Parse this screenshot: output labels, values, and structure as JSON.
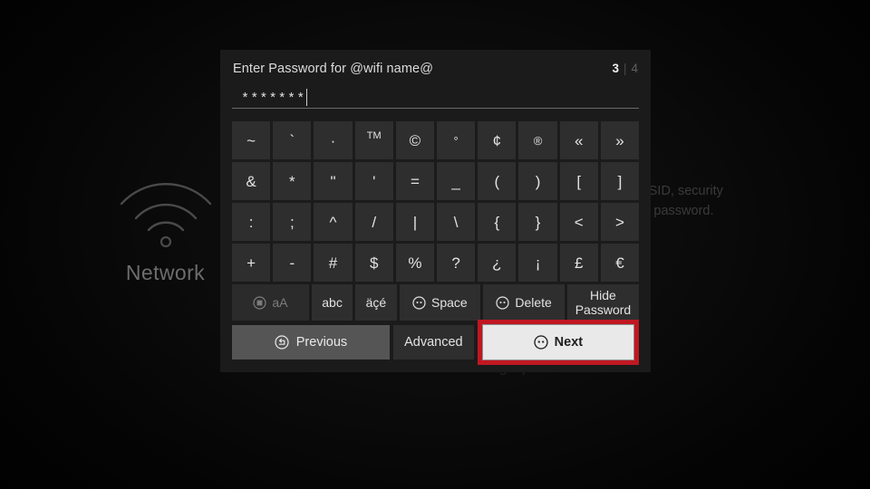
{
  "background": {
    "network_icon": "wifi-icon",
    "network_label": "Network",
    "description": "ecify your SSID, security\n e, and enter password.",
    "description_line1": "ecify your SSID, security",
    "description_line2": "e, and enter password.",
    "tips_label": "Basic Wi-Fi Troubleshooting Tips"
  },
  "dialog": {
    "title": "Enter Password for @wifi name@",
    "step_current": "3",
    "step_separator": "|",
    "step_total": "4",
    "password_field": {
      "value": "*******",
      "masked_char_count": 7,
      "placeholder": ""
    },
    "keyboard": {
      "rows": [
        [
          "~",
          "`",
          "·",
          "TM",
          "©",
          "°",
          "¢",
          "®",
          "«",
          "»"
        ],
        [
          "&",
          "*",
          "\"",
          "'",
          "=",
          "_",
          "(",
          ")",
          "[",
          "]"
        ],
        [
          ":",
          ";",
          "^",
          "/",
          "|",
          "\\",
          "{",
          "}",
          "<",
          ">"
        ],
        [
          "+",
          "-",
          "#",
          "$",
          "%",
          "?",
          "¿",
          "¡",
          "£",
          "€"
        ]
      ],
      "function_keys": [
        {
          "label": "aA",
          "icon": "circle-square-icon",
          "state": "dimmed"
        },
        {
          "label": "abc",
          "icon": "",
          "state": "normal"
        },
        {
          "label": "äçé",
          "icon": "",
          "state": "normal"
        },
        {
          "label": "Space",
          "icon": "remote-ok-icon",
          "state": "normal"
        },
        {
          "label": "Delete",
          "icon": "remote-ok-icon",
          "state": "normal"
        },
        {
          "label_line1": "Hide",
          "label_line2": "Password",
          "icon": "",
          "state": "normal"
        }
      ]
    },
    "actions": {
      "previous": {
        "label": "Previous",
        "icon": "circle-back-arrow-icon"
      },
      "advanced": {
        "label": "Advanced",
        "icon": ""
      },
      "next": {
        "label": "Next",
        "icon": "remote-ok-icon",
        "highlighted": true,
        "highlight_color": "#c01722"
      }
    }
  },
  "colors": {
    "dialog_bg": "#1b1b1b",
    "key_bg": "#2e2e2e",
    "key_text": "#e3e3e3",
    "accent_highlight": "#c01722",
    "next_button_bg": "#e9e9e9"
  }
}
